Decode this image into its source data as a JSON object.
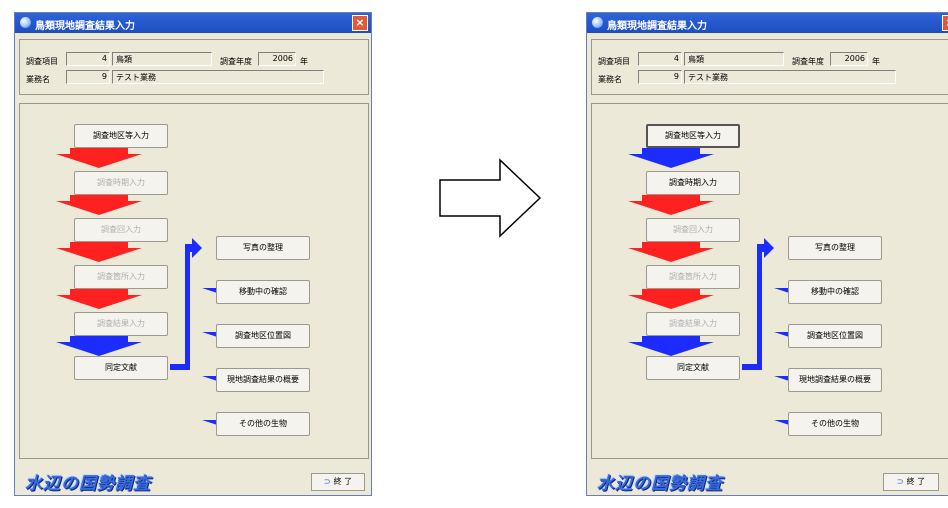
{
  "window_title": "鳥類現地調査結果入力",
  "close_glyph": "×",
  "labels": {
    "survey_item": "調査項目",
    "business_name": "業務名",
    "survey_year": "調査年度",
    "year_unit": "年"
  },
  "fields": {
    "survey_item_no": "4",
    "survey_item_name": "鳥類",
    "business_no": "9",
    "business_name": "テスト業務",
    "survey_year": "2006"
  },
  "flow_buttons": {
    "area_input": "調査地区等入力",
    "period_input": "調査時期入力",
    "count_input": "調査回入力",
    "place_input": "調査箇所入力",
    "result_input": "調査結果入力",
    "reference": "同定文献",
    "photos": "写真の整理",
    "moving_check": "移動中の確認",
    "area_map": "調査地区位置図",
    "summary": "現地調査結果の概要",
    "other_creatures": "その他の生物"
  },
  "logo_text": "水辺の国勢調査",
  "end_button": "終 了",
  "colors": {
    "red_arrow": "#ff2020",
    "blue_arrow": "#1c2cff",
    "title_bar": "#2f63d8",
    "panel_bg": "#ece9d8"
  },
  "icons": [
    "close-icon",
    "app-icon",
    "exit-icon",
    "transition-arrow-icon"
  ]
}
